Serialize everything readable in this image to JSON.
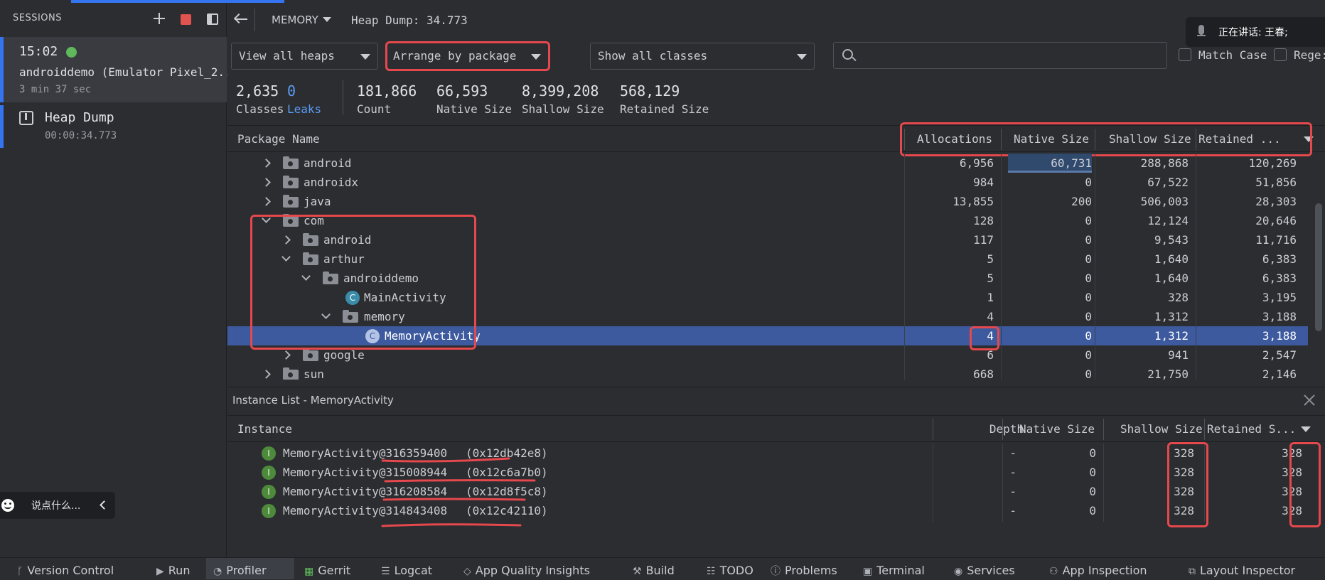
{
  "sessions": {
    "title": "SESSIONS",
    "session": {
      "time": "15:02",
      "name": "androiddemo (Emulator Pixel_2...",
      "duration": "3 min 37 sec"
    },
    "heap_dump": {
      "label": "Heap Dump",
      "time": "00:00:34.773"
    }
  },
  "toolbar": {
    "profiler": "MEMORY",
    "heap_dump": "Heap Dump: 34.773"
  },
  "filters": {
    "heap": "View all heaps",
    "arrange": "Arrange by package",
    "classes": "Show all classes",
    "search_placeholder": "",
    "match_case": "Match Case",
    "regex": "Rege:"
  },
  "voice": {
    "text": "正在讲话:  王春;"
  },
  "stats": [
    {
      "value": "2,635",
      "label": "Classes"
    },
    {
      "value": "0",
      "label": "Leaks"
    },
    {
      "value": "181,866",
      "label": "Count"
    },
    {
      "value": "66,593",
      "label": "Native Size"
    },
    {
      "value": "8,399,208",
      "label": "Shallow Size"
    },
    {
      "value": "568,129",
      "label": "Retained Size"
    }
  ],
  "class_table": {
    "columns": [
      "Package Name",
      "Allocations",
      "Native Size",
      "Shallow Size",
      "Retained ..."
    ],
    "rows": [
      {
        "name": "android",
        "alloc": "6,956",
        "native": "60,731",
        "shallow": "288,868",
        "retained": "120,269"
      },
      {
        "name": "androidx",
        "alloc": "984",
        "native": "0",
        "shallow": "67,522",
        "retained": "51,856"
      },
      {
        "name": "java",
        "alloc": "13,855",
        "native": "200",
        "shallow": "506,003",
        "retained": "28,303"
      },
      {
        "name": "com",
        "alloc": "128",
        "native": "0",
        "shallow": "12,124",
        "retained": "20,646"
      },
      {
        "name": "android",
        "alloc": "117",
        "native": "0",
        "shallow": "9,543",
        "retained": "11,716"
      },
      {
        "name": "arthur",
        "alloc": "5",
        "native": "0",
        "shallow": "1,640",
        "retained": "6,383"
      },
      {
        "name": "androiddemo",
        "alloc": "5",
        "native": "0",
        "shallow": "1,640",
        "retained": "6,383"
      },
      {
        "name": "MainActivity",
        "alloc": "1",
        "native": "0",
        "shallow": "328",
        "retained": "3,195"
      },
      {
        "name": "memory",
        "alloc": "4",
        "native": "0",
        "shallow": "1,312",
        "retained": "3,188"
      },
      {
        "name": "MemoryActivity",
        "alloc": "4",
        "native": "0",
        "shallow": "1,312",
        "retained": "3,188"
      },
      {
        "name": "google",
        "alloc": "6",
        "native": "0",
        "shallow": "941",
        "retained": "2,547"
      },
      {
        "name": "sun",
        "alloc": "668",
        "native": "0",
        "shallow": "21,750",
        "retained": "2,146"
      }
    ]
  },
  "instance_list": {
    "title": "Instance List - MemoryActivity",
    "columns": [
      "Instance",
      "Depth",
      "Native Size",
      "Shallow Size",
      "Retained S..."
    ],
    "rows": [
      {
        "name": "MemoryActivity@316359400",
        "addr": "0x12db42e8",
        "depth": "-",
        "native": "0",
        "shallow": "328",
        "retained": "328"
      },
      {
        "name": "MemoryActivity@315008944",
        "addr": "0x12c6a7b0",
        "depth": "-",
        "native": "0",
        "shallow": "328",
        "retained": "328"
      },
      {
        "name": "MemoryActivity@316208584",
        "addr": "0x12d8f5c8",
        "depth": "-",
        "native": "0",
        "shallow": "328",
        "retained": "328"
      },
      {
        "name": "MemoryActivity@314843408",
        "addr": "0x12c42110",
        "depth": "-",
        "native": "0",
        "shallow": "328",
        "retained": "328"
      }
    ]
  },
  "chat": {
    "placeholder": "说点什么..."
  },
  "bottom_bar": [
    "Version Control",
    "Run",
    "Profiler",
    "Gerrit",
    "Logcat",
    "App Quality Insights",
    "Build",
    "TODO",
    "Problems",
    "Terminal",
    "Services",
    "App Inspection",
    "Layout Inspector"
  ],
  "colors": {
    "accent": "#3d5a9f",
    "link": "#5c9df5",
    "highlight": "#e5484d",
    "status_green": "#5fb85c"
  }
}
